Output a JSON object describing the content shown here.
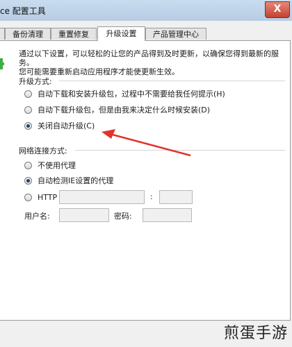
{
  "window": {
    "title": "ce 配置工具",
    "close_glyph": "X"
  },
  "tabs": [
    {
      "label": "备份清理",
      "active": false
    },
    {
      "label": "重置修复",
      "active": false
    },
    {
      "label": "升级设置",
      "active": true
    },
    {
      "label": "产品管理中心",
      "active": false
    }
  ],
  "intro": {
    "line1": "通过以下设置，可以轻松的让您的产品得到及时更新，以确保您得到最新的服务。",
    "line2": "您可能需要重新启动应用程序才能使更新生效。"
  },
  "upgrade": {
    "title": "升级方式:",
    "options": [
      {
        "label": "自动下载和安装升级包，过程中不需要给我任何提示(H)",
        "checked": false
      },
      {
        "label": "自动下载升级包，但是由我来决定什么时候安装(D)",
        "checked": false
      },
      {
        "label": "关闭自动升级(C)",
        "checked": true
      }
    ]
  },
  "network": {
    "title": "网络连接方式:",
    "options": [
      {
        "label": "不使用代理",
        "checked": false
      },
      {
        "label": "自动检测IE设置的代理",
        "checked": true
      },
      {
        "label": "HTTP",
        "checked": false
      }
    ],
    "port_separator": ":",
    "host_value": "",
    "port_value": "",
    "username_label": "用户名:",
    "username_value": "",
    "password_label": "密码:",
    "password_value": ""
  },
  "annotation": {
    "arrow_color": "#e0332b"
  },
  "watermark": "煎蛋手游"
}
